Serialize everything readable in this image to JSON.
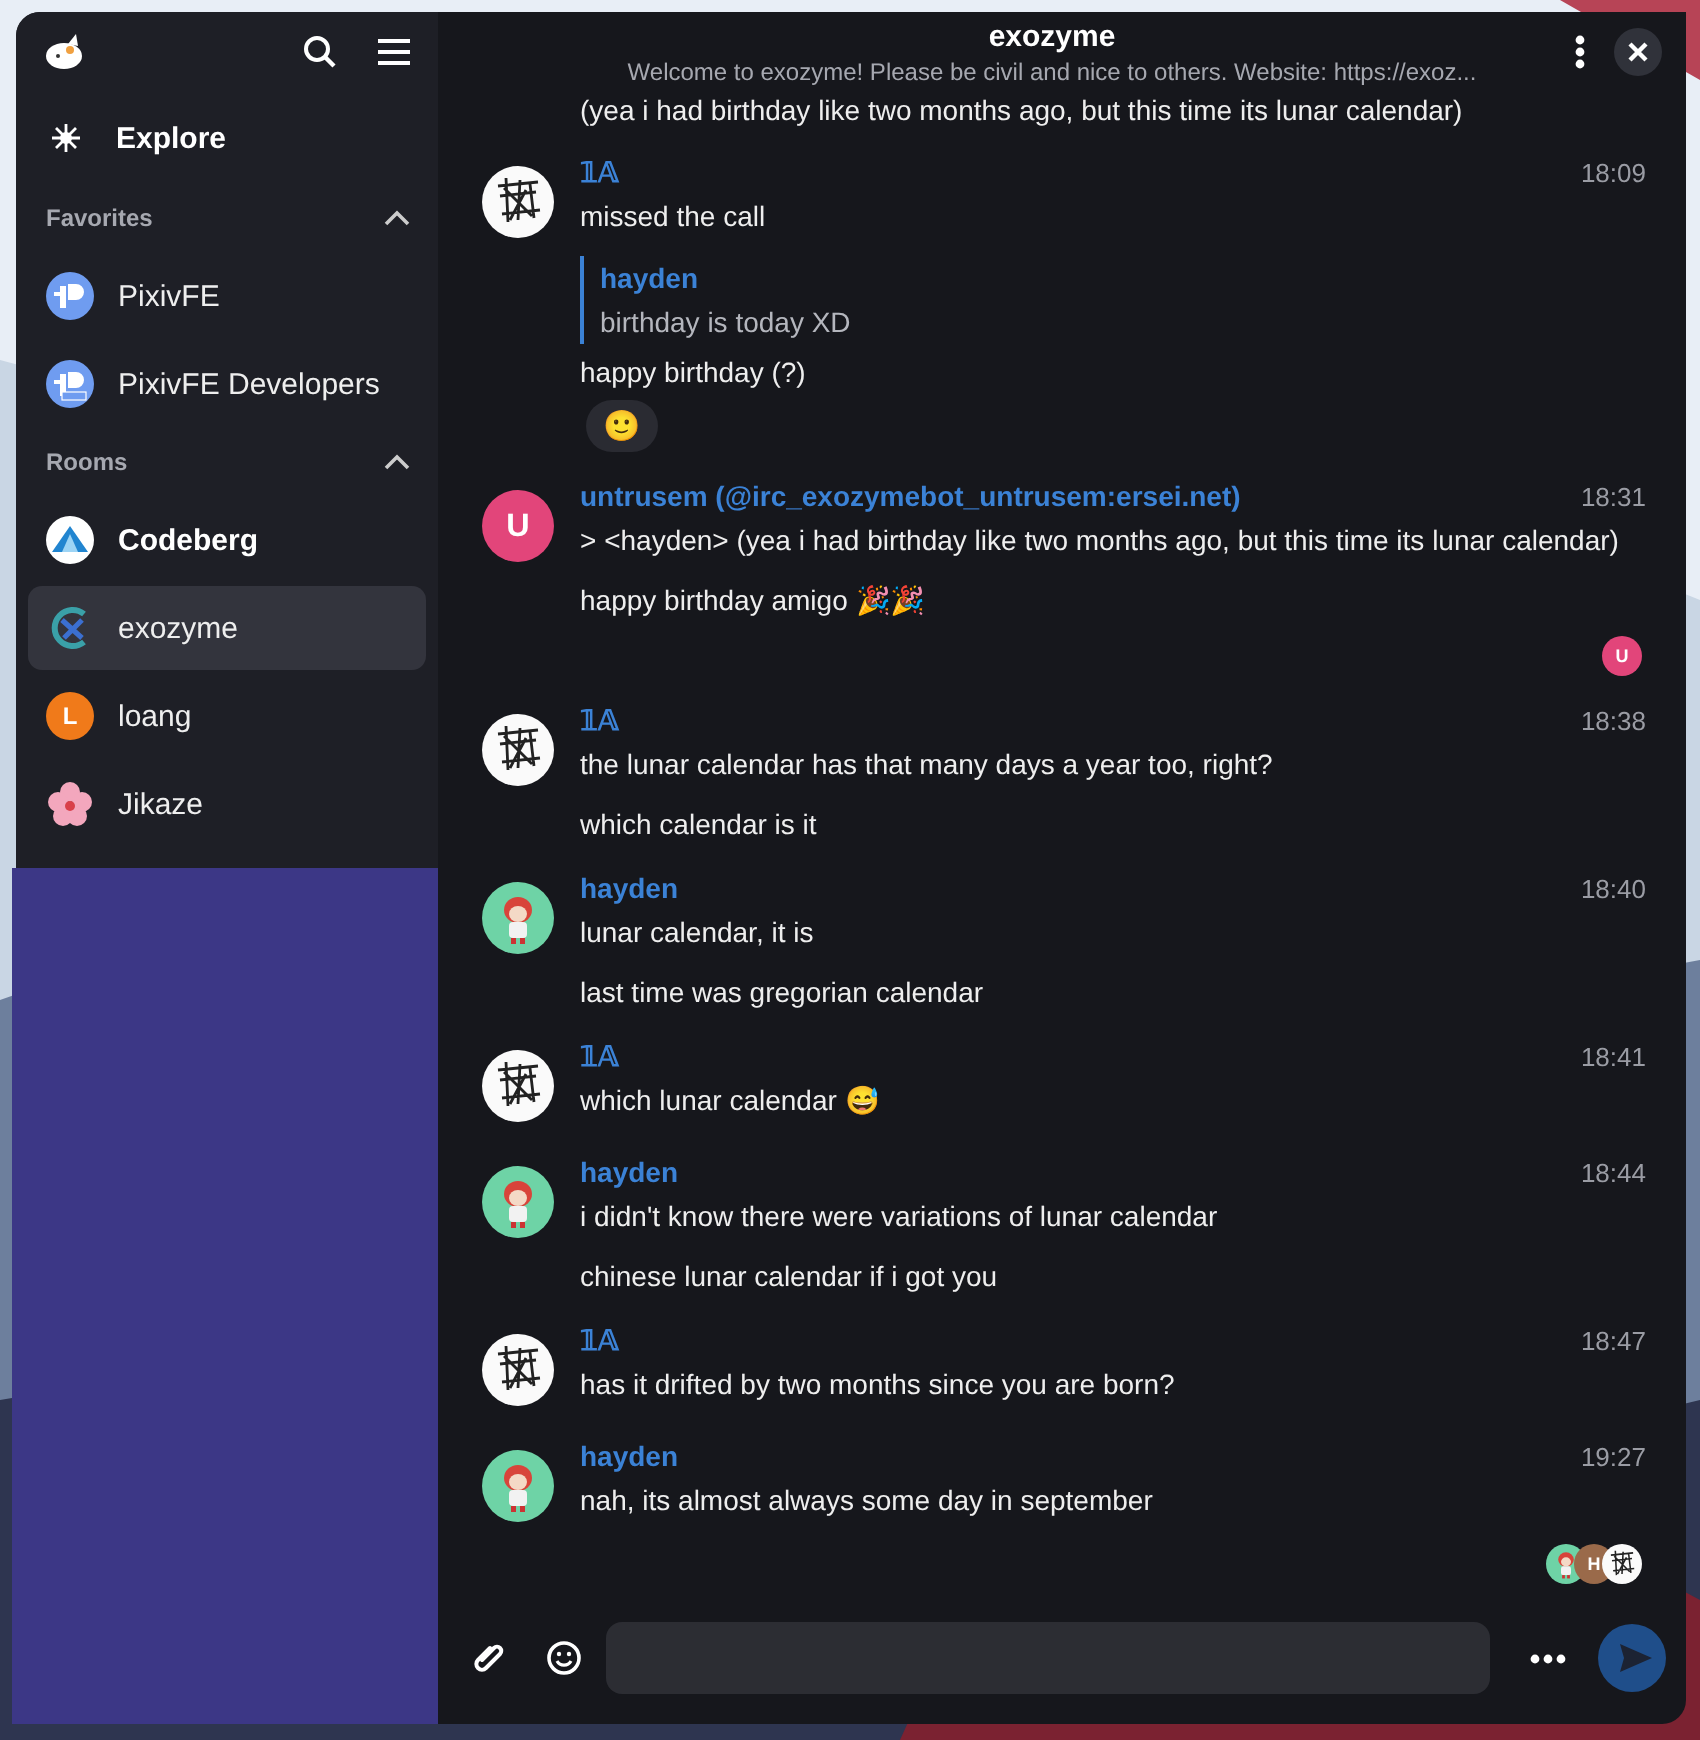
{
  "sidebar": {
    "explore": "Explore",
    "sections": [
      {
        "title": "Favorites",
        "expanded": true,
        "rooms": [
          {
            "name": "PixivFE",
            "kind": "pixiv",
            "unread": false,
            "selected": false
          },
          {
            "name": "PixivFE Developers",
            "kind": "pixiv-dev",
            "unread": false,
            "selected": false
          }
        ]
      },
      {
        "title": "Rooms",
        "expanded": true,
        "rooms": [
          {
            "name": "Codeberg",
            "kind": "codeberg",
            "unread": true,
            "selected": false
          },
          {
            "name": "exozyme",
            "kind": "exozyme",
            "unread": false,
            "selected": true
          },
          {
            "name": "loang",
            "kind": "letter",
            "letter": "L",
            "color": "#f07a1a",
            "unread": false,
            "selected": false
          },
          {
            "name": "Jikaze",
            "kind": "flower",
            "unread": false,
            "selected": false
          }
        ]
      }
    ]
  },
  "room": {
    "title": "exozyme",
    "topic": "Welcome to exozyme! Please be civil and nice to others. Website: https://exoz..."
  },
  "timeline": {
    "continued": "(yea i had birthday like two months ago, but this time its lunar calendar)",
    "groups": [
      {
        "author": "𝟙𝔸",
        "avatar": {
          "kind": "sketch"
        },
        "time": "18:09",
        "items": [
          {
            "kind": "text",
            "text": "missed the call"
          },
          {
            "kind": "quote",
            "author": "hayden",
            "text": "birthday is today XD"
          },
          {
            "kind": "text",
            "text": "happy birthday (?)"
          },
          {
            "kind": "reaction",
            "emoji": "🙂"
          }
        ]
      },
      {
        "author": "untrusem (@irc_exozymebot_untrusem:ersei.net)",
        "avatar": {
          "kind": "letter",
          "letter": "U",
          "color": "#e2457a"
        },
        "time": "18:31",
        "items": [
          {
            "kind": "text",
            "text": "> <hayden> (yea i had birthday like two months ago, but this time its lunar calendar)"
          },
          {
            "kind": "text",
            "text": "happy birthday amigo 🎉🎉"
          }
        ],
        "receipts": [
          {
            "kind": "letter",
            "letter": "U",
            "color": "#e2457a"
          }
        ]
      },
      {
        "author": "𝟙𝔸",
        "avatar": {
          "kind": "sketch"
        },
        "time": "18:38",
        "items": [
          {
            "kind": "text",
            "text": "the lunar calendar has that many days a year too, right?"
          },
          {
            "kind": "text",
            "text": "which calendar is it"
          }
        ]
      },
      {
        "author": "hayden",
        "avatar": {
          "kind": "character"
        },
        "time": "18:40",
        "items": [
          {
            "kind": "text",
            "text": "lunar calendar, it is"
          },
          {
            "kind": "text",
            "text": "last time was gregorian calendar"
          }
        ]
      },
      {
        "author": "𝟙𝔸",
        "avatar": {
          "kind": "sketch"
        },
        "time": "18:41",
        "items": [
          {
            "kind": "text",
            "text": "which lunar calendar 😅"
          }
        ]
      },
      {
        "author": "hayden",
        "avatar": {
          "kind": "character"
        },
        "time": "18:44",
        "items": [
          {
            "kind": "text",
            "text": "i didn't know there were variations of lunar calendar"
          },
          {
            "kind": "text",
            "text": "chinese lunar calendar if i got you"
          }
        ]
      },
      {
        "author": "𝟙𝔸",
        "avatar": {
          "kind": "sketch"
        },
        "time": "18:47",
        "items": [
          {
            "kind": "text",
            "text": "has it drifted by two months since you are born?"
          }
        ]
      },
      {
        "author": "hayden",
        "avatar": {
          "kind": "character"
        },
        "time": "19:27",
        "items": [
          {
            "kind": "text",
            "text": "nah, its almost always some day in september"
          }
        ],
        "receipts": [
          {
            "kind": "character"
          },
          {
            "kind": "letter",
            "letter": "H",
            "color": "#9a6a4a"
          },
          {
            "kind": "sketch"
          }
        ]
      }
    ]
  }
}
